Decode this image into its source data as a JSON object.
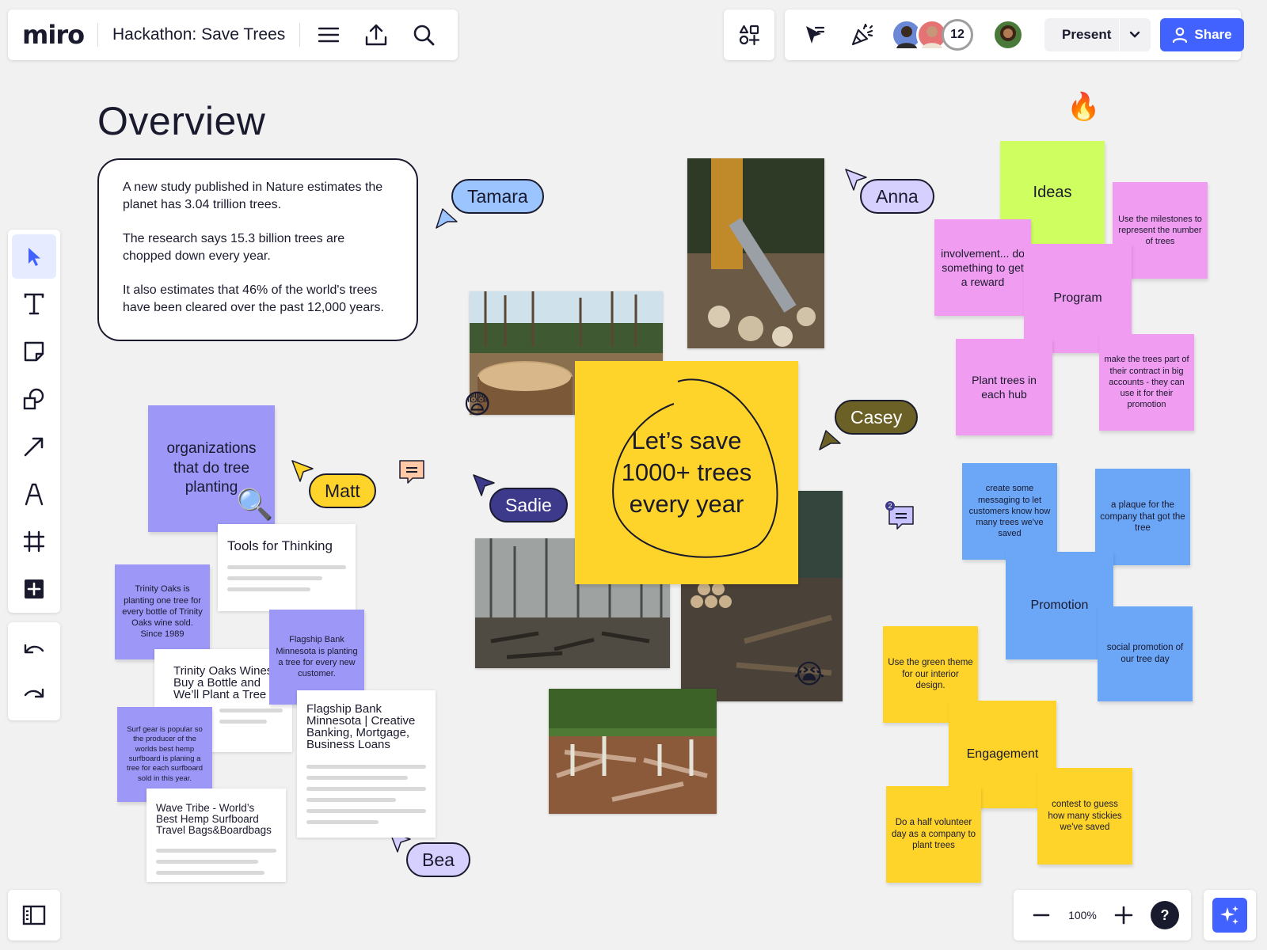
{
  "app": {
    "logo": "miro",
    "board_title": "Hackathon: Save Trees"
  },
  "collaborators": {
    "extra_count": "12"
  },
  "header": {
    "present_label": "Present",
    "share_label": "Share"
  },
  "zoom": {
    "level": "100%",
    "help": "?"
  },
  "canvas": {
    "title": "Overview",
    "facts": [
      "A new study published in Nature estimates the planet has 3.04 trillion trees.",
      "The research says 15.3 billion trees are chopped down every year.",
      "It also estimates that 46% of the world's trees have been cleared over the past 12,000 years."
    ],
    "main_goal": "Let’s save 1000+ trees every year",
    "cursors": {
      "tamara": "Tamara",
      "anna": "Anna",
      "casey": "Casey",
      "matt": "Matt",
      "sadie": "Sadie",
      "bea": "Bea"
    },
    "purple_notes": {
      "organizations": "organizations that do tree planting",
      "trinity": "Trinity Oaks is planting one tree for every bottle of Trinity Oaks wine sold. Since 1989",
      "flagship": "Flagship Bank Minnesota is planting a tree for every new customer.",
      "surf": "Surf gear is popular so the producer of the worlds best hemp surfboard is planing a tree for each surfboard sold in this year."
    },
    "cards": {
      "tools": "Tools for Thinking",
      "trinity": "Trinity Oaks Wines Buy a Bottle and We’ll Plant a Tree",
      "flagship": "Flagship Bank Minnesota | Creative Banking, Mortgage, Business Loans",
      "wave": "Wave Tribe - World’s Best Hemp Surfboard Travel Bags&Boardbags"
    },
    "ideas_cluster": {
      "ideas": "Ideas",
      "milestones": "Use the milestones to represent the number of trees",
      "involvement": "involvement... do something to get a reward",
      "program": "Program",
      "plant_hub": "Plant trees in each hub",
      "contract": "make the trees part of their contract in big accounts - they can use it for their promotion"
    },
    "promotion_cluster": {
      "messaging": "create some messaging to let customers know how many trees we've saved",
      "plaque": "a plaque for the company that got the tree",
      "promotion": "Promotion",
      "social": "social promotion of our tree day"
    },
    "engagement_cluster": {
      "green_theme": "Use the green theme for our interior design.",
      "engagement": "Engagement",
      "volunteer": "Do a half volunteer day as a company to plant trees",
      "contest": "contest to guess how many stickies we've saved"
    },
    "comment_count": "2"
  },
  "emojis": {
    "fire": "🔥",
    "fearful": "😨",
    "crying": "😭",
    "magnifier": "🔍"
  },
  "colors": {
    "accent": "#4262ff",
    "yellow": "#ffd42a",
    "purple": "#9d97f8",
    "pink": "#f09cf0",
    "lime": "#cffe60",
    "blue": "#6ba6f7"
  }
}
